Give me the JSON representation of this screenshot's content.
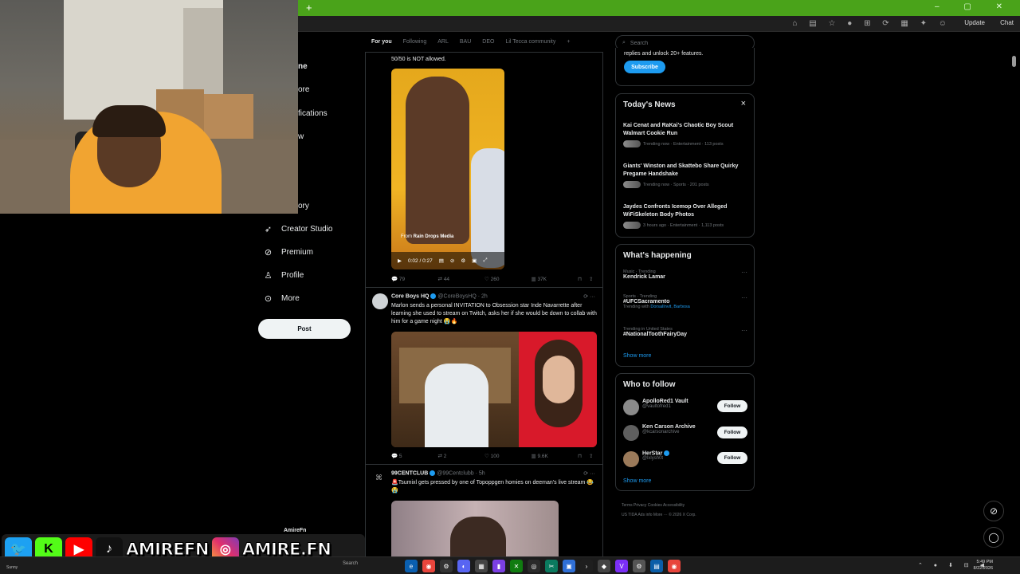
{
  "browser": {
    "new_tab": "+",
    "update_label": "Update",
    "chat_label": "Chat"
  },
  "webcam": {
    "label": ""
  },
  "nav": {
    "peeks": [
      "ne",
      "ore",
      "fications",
      "w",
      "ory"
    ],
    "items": [
      {
        "label": "Creator Studio",
        "icon": "rocket-icon"
      },
      {
        "label": "Premium",
        "icon": "premium-badge-icon"
      },
      {
        "label": "Profile",
        "icon": "person-icon"
      },
      {
        "label": "More",
        "icon": "more-circle-icon"
      }
    ],
    "post_label": "Post",
    "account_name": "AmireFn"
  },
  "tabs": [
    "For you",
    "Following",
    "ARL",
    "BAU",
    "DEO",
    "Lil Tecca community",
    "+"
  ],
  "feed": {
    "post1": {
      "text": "50/50 is NOT allowed.",
      "media_from": "From",
      "media_source": "Rain Drops Media",
      "video_time": "0:02 / 0:27",
      "replies": "79",
      "reposts": "44",
      "likes": "260",
      "views": "37K"
    },
    "post2": {
      "name": "Core Boys HQ",
      "handle": "@CoreBoysHQ",
      "time": "· 2h",
      "text": "Marlon sends a personal INVITATION to Obsession star Inde Navarrette after learning she used to stream on Twitch, asks her if she would be down to collab with him for a game night 😭🔥",
      "replies": "5",
      "reposts": "2",
      "likes": "100",
      "views": "9.6K"
    },
    "post3": {
      "name": "99CENTCLUB",
      "handle": "@99Centclubb",
      "time": "· 5h",
      "text": "🚨Tsumixl gets pressed by one of Topoppgen homies on deeman's live stream 😂😭"
    }
  },
  "sidebar": {
    "search_placeholder": "Search",
    "premium": {
      "text": "replies and unlock 20+ features.",
      "subscribe": "Subscribe"
    },
    "news": {
      "title": "Today's News",
      "close": "×",
      "items": [
        {
          "title": "Kai Cenat and RaKai's Chaotic Boy Scout Walmart Cookie Run",
          "meta": "Trending now · Entertainment · 113 posts"
        },
        {
          "title": "Giants' Winston and Skattebo Share Quirky Pregame Handshake",
          "meta": "Trending now · Sports · 201 posts"
        },
        {
          "title": "Jaydes Confronts Icemop Over Alleged WiFiSkeleton Body Photos",
          "meta": "3 hours ago · Entertainment · 1,113 posts"
        }
      ]
    },
    "happening": {
      "title": "What's happening",
      "items": [
        {
          "category": "Music · Trending",
          "name": "Kendrick Lamar",
          "with": "",
          "with_links": ""
        },
        {
          "category": "Sports · Trending",
          "name": "#UFCSacramento",
          "with": "Trending with",
          "with_links": "DorsalInvit, Barbosa"
        },
        {
          "category": "Trending in United States",
          "name": "#NationalToothFairyDay",
          "with": "",
          "with_links": ""
        }
      ],
      "show_more": "Show more"
    },
    "follow": {
      "title": "Who to follow",
      "users": [
        {
          "name": "ApolloRed1 Vault",
          "handle": "@vaultofred1",
          "button": "Follow"
        },
        {
          "name": "Ken Carson Archive",
          "handle": "@kcarsonarchive",
          "button": "Follow"
        },
        {
          "name": "HerStar",
          "handle": "@lxlysh0t",
          "button": "Follow"
        }
      ],
      "show_more": "Show more"
    },
    "footer": {
      "line1": "Terms    Privacy    Cookies    Accessibility",
      "line2": "US TIDA    Ads info    More ···    © 2026 X Corp."
    }
  },
  "overlay": {
    "handle1": "AMIREFN",
    "handle2": "AMIRE.FN"
  },
  "taskbar": {
    "weather": "Sunny",
    "search": "Search",
    "time": "5:49 PM",
    "date": "8/22/2026"
  }
}
